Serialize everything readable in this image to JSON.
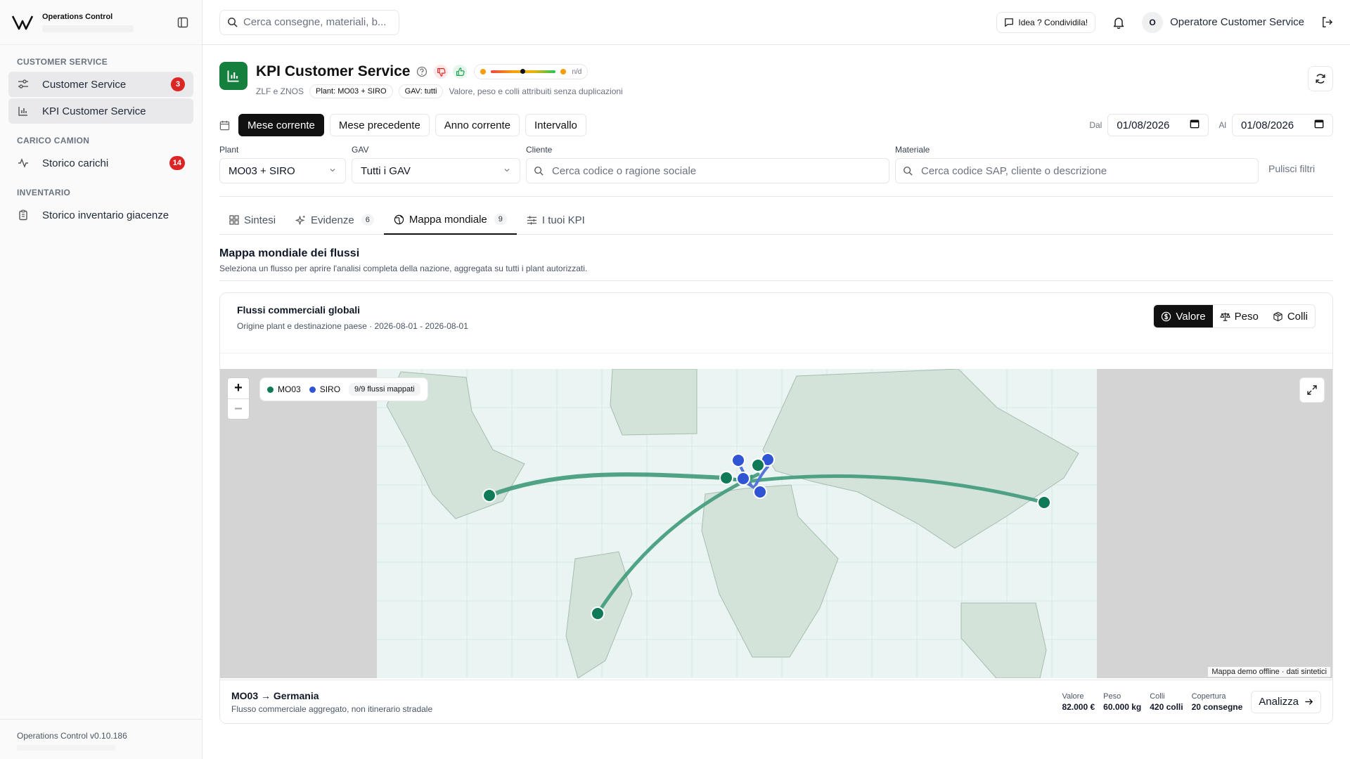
{
  "sidebar": {
    "brand": "Operations Control",
    "sections": [
      {
        "title": "CUSTOMER SERVICE",
        "items": [
          {
            "label": "Customer Service",
            "badge": "3",
            "active": true,
            "icon": "sliders-icon"
          },
          {
            "label": "KPI Customer Service",
            "badge": "",
            "active": true,
            "icon": "bar-chart-icon"
          }
        ]
      },
      {
        "title": "CARICO CAMION",
        "items": [
          {
            "label": "Storico carichi",
            "badge": "14",
            "active": false,
            "icon": "activity-icon"
          }
        ]
      },
      {
        "title": "INVENTARIO",
        "items": [
          {
            "label": "Storico inventario giacenze",
            "badge": "",
            "active": false,
            "icon": "clipboard-icon"
          }
        ]
      }
    ],
    "version": "Operations Control v0.10.186"
  },
  "topbar": {
    "search_placeholder": "Cerca consegne, materiali, b...",
    "idea_label": "Idea ? Condividila!",
    "user_initial": "O",
    "user_name": "Operatore Customer Service"
  },
  "header": {
    "title": "KPI Customer Service",
    "gauge_label": "n/d",
    "subtitle": "ZLF e ZNOS",
    "chips": [
      "Plant: MO03 + SIRO",
      "GAV: tutti"
    ],
    "note": "Valore, peso e colli attribuiti senza duplicazioni"
  },
  "periods": {
    "buttons": [
      "Mese corrente",
      "Mese precedente",
      "Anno corrente",
      "Intervallo"
    ],
    "active": "Mese corrente",
    "from_label": "Dal",
    "from_value": "01/08/2026",
    "to_label": "Al",
    "to_value": "01/08/2026"
  },
  "filters": {
    "plant_label": "Plant",
    "plant_value": "MO03 + SIRO",
    "gav_label": "GAV",
    "gav_value": "Tutti i GAV",
    "cliente_label": "Cliente",
    "cliente_placeholder": "Cerca codice o ragione sociale",
    "materiale_label": "Materiale",
    "materiale_placeholder": "Cerca codice SAP, cliente o descrizione",
    "clear_label": "Pulisci filtri"
  },
  "tabs": [
    {
      "label": "Sintesi",
      "count": "",
      "icon": "grid-icon"
    },
    {
      "label": "Evidenze",
      "count": "6",
      "icon": "sparkles-icon"
    },
    {
      "label": "Mappa mondiale",
      "count": "9",
      "icon": "globe-icon",
      "active": true
    },
    {
      "label": "I tuoi KPI",
      "count": "",
      "icon": "sliders-icon"
    }
  ],
  "section": {
    "title": "Mappa mondiale dei flussi",
    "subtitle": "Seleziona un flusso per aprire l'analisi completa della nazione, aggregata su tutti i plant autorizzati."
  },
  "card": {
    "title": "Flussi commerciali globali",
    "subtitle": "Origine plant e destinazione paese · 2026-08-01 - 2026-08-01",
    "metrics": [
      "Valore",
      "Peso",
      "Colli"
    ],
    "active_metric": "Valore"
  },
  "map": {
    "zoom_in": "+",
    "zoom_out": "−",
    "legend": [
      {
        "label": "MO03",
        "color": "#0f7a57"
      },
      {
        "label": "SIRO",
        "color": "#2f55d4"
      }
    ],
    "mapped_count": "9/9 flussi mappati",
    "attribution": "Mappa demo offline · dati sintetici",
    "flow_color": "#3f9a79"
  },
  "footer": {
    "flow_title": "MO03 → Germania",
    "flow_sub": "Flusso commerciale aggregato, non itinerario stradale",
    "stats": [
      {
        "label": "Valore",
        "value": "82.000 €"
      },
      {
        "label": "Peso",
        "value": "60.000 kg"
      },
      {
        "label": "Colli",
        "value": "420 colli"
      },
      {
        "label": "Copertura",
        "value": "20 consegne"
      }
    ],
    "action_label": "Analizza"
  }
}
